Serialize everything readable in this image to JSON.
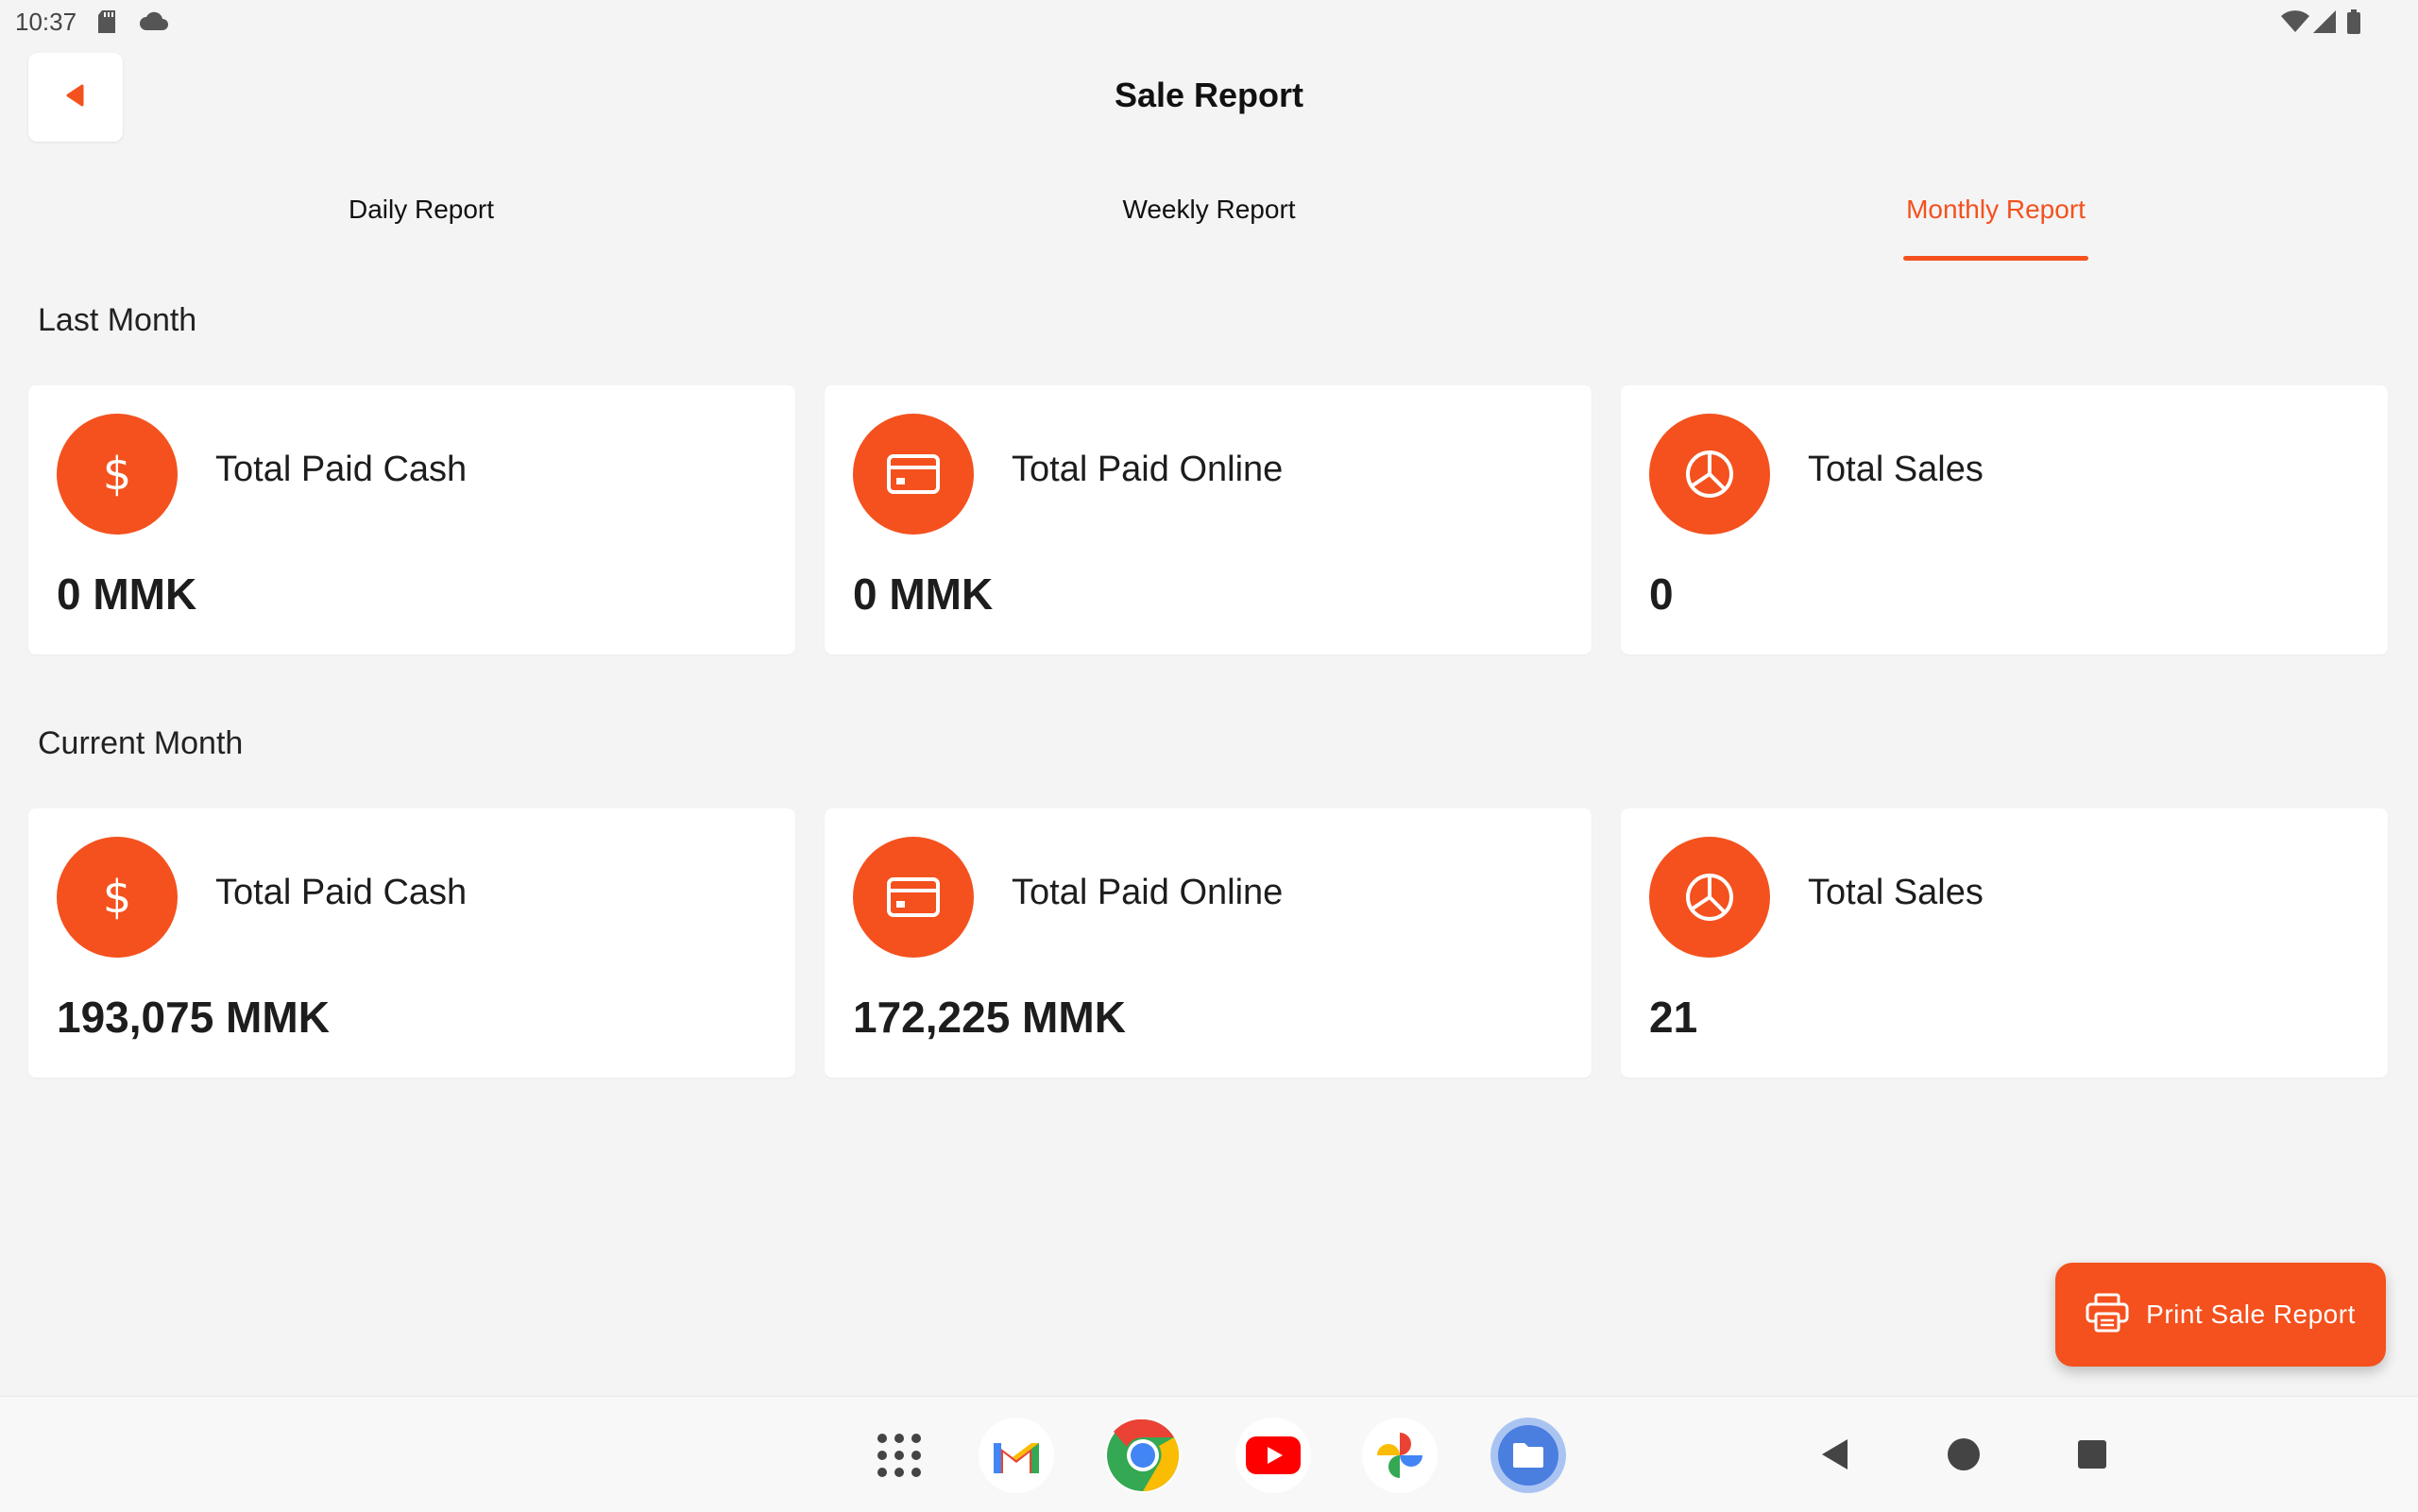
{
  "status_bar": {
    "time": "10:37"
  },
  "header": {
    "title": "Sale Report"
  },
  "tabs": [
    {
      "label": "Daily Report",
      "active": false
    },
    {
      "label": "Weekly Report",
      "active": false
    },
    {
      "label": "Monthly Report",
      "active": true
    }
  ],
  "sections": [
    {
      "title": "Last Month",
      "cards": [
        {
          "icon": "dollar-icon",
          "label": "Total Paid Cash",
          "value": "0 MMK"
        },
        {
          "icon": "credit-card-icon",
          "label": "Total Paid Online",
          "value": "0 MMK"
        },
        {
          "icon": "pie-chart-icon",
          "label": "Total Sales",
          "value": "0"
        }
      ]
    },
    {
      "title": "Current Month",
      "cards": [
        {
          "icon": "dollar-icon",
          "label": "Total Paid Cash",
          "value": "193,075 MMK"
        },
        {
          "icon": "credit-card-icon",
          "label": "Total Paid Online",
          "value": "172,225 MMK"
        },
        {
          "icon": "pie-chart-icon",
          "label": "Total Sales",
          "value": "21"
        }
      ]
    }
  ],
  "fab": {
    "label": "Print Sale Report",
    "icon": "printer-icon"
  },
  "icons": {
    "dollar_glyph": "$"
  },
  "taskbar": {
    "apps": [
      "app-drawer-icon",
      "gmail-icon",
      "chrome-icon",
      "youtube-icon",
      "photos-icon",
      "files-icon"
    ],
    "nav": [
      "nav-back-icon",
      "nav-home-icon",
      "nav-recents-icon"
    ]
  },
  "colors": {
    "accent": "#f4511e",
    "background": "#f4f4f4",
    "card": "#ffffff",
    "text": "#1d1d1d"
  }
}
